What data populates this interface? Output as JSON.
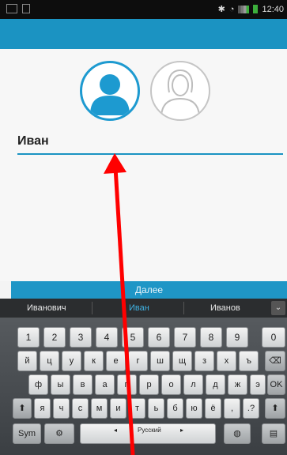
{
  "status_bar": {
    "time": "12:40"
  },
  "profile": {
    "name_value": "Иван"
  },
  "next_button": {
    "label": "Далее"
  },
  "keyboard": {
    "suggestions": [
      "Иванович",
      "Иван",
      "Иванов"
    ],
    "row1": [
      "1",
      "2",
      "3",
      "4",
      "5",
      "6",
      "7",
      "8",
      "9",
      "0"
    ],
    "row2": [
      "й",
      "ц",
      "у",
      "к",
      "е",
      "г",
      "ш",
      "щ",
      "з",
      "х",
      "ъ"
    ],
    "row3": [
      "ф",
      "ы",
      "в",
      "а",
      "п",
      "р",
      "о",
      "л",
      "д",
      "ж",
      "э"
    ],
    "row4": [
      "я",
      "ч",
      "с",
      "м",
      "и",
      "т",
      "ь",
      "б",
      "ю",
      "ё",
      ",",
      ".?"
    ],
    "sym_label": "Sym",
    "space_label": "Русский",
    "ok_label": "OK"
  },
  "colors": {
    "accent": "#1b93c2",
    "annotation_arrow": "#ff0000"
  }
}
